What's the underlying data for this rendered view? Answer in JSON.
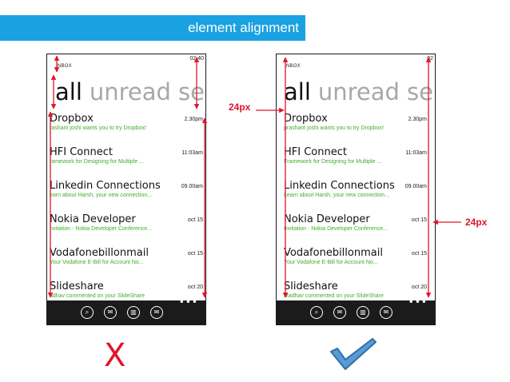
{
  "banner": {
    "title": "element alignment"
  },
  "phones": [
    {
      "status_time": "02:40",
      "inbox_label": "NBOX",
      "pivot": {
        "active": "all",
        "inactive": [
          "unread",
          "se"
        ]
      },
      "items": [
        {
          "title": "Dropbox",
          "subtitle": "rashant joshi wants you to try Dropbox!",
          "date": "2.30pm"
        },
        {
          "title": "HFI Connect",
          "subtitle": "ramework for Designing for Multiple ...",
          "date": "11:03am"
        },
        {
          "title": "Linkedin Connections",
          "subtitle": "earn about Harsh, your new connection...",
          "date": "09.00am"
        },
        {
          "title": "Nokia Developer",
          "subtitle": "nvitation - Nokia Developer Conference...",
          "date": "oct 15"
        },
        {
          "title": "Vodafonebillonmail",
          "subtitle": "Your Vodafone E-Bill for Account No...",
          "date": "oct 15"
        },
        {
          "title": "Slideshare",
          "subtitle": "adhav commented on your SlideShare",
          "date": "oct 20"
        }
      ]
    },
    {
      "status_time": "02",
      "inbox_label": "NBOX",
      "pivot": {
        "active": "all",
        "inactive": [
          "unread",
          "se"
        ]
      },
      "items": [
        {
          "title": "Dropbox",
          "subtitle": "prashant joshi wants you to try Dropbox!",
          "date": "2.30pm"
        },
        {
          "title": "HFI Connect",
          "subtitle": "Framework for Designing for Multiple ...",
          "date": "11:03am"
        },
        {
          "title": "Linkedin Connections",
          "subtitle": "Learn about Harsh, your new connection...",
          "date": "09.00am"
        },
        {
          "title": "Nokia Developer",
          "subtitle": "Invitation - Nokia Developer Conference...",
          "date": "oct 15"
        },
        {
          "title": "Vodafonebillonmail",
          "subtitle": "Your Vodafone E-Bill for Account No...",
          "date": "oct 15"
        },
        {
          "title": "Slideshare",
          "subtitle": "Madhav commented on your SlideShare",
          "date": "oct 20"
        }
      ]
    }
  ],
  "app_bar": {
    "icons": [
      "search-icon",
      "email-icon",
      "delete-icon",
      "compose-icon"
    ],
    "more": "•••"
  },
  "annotations": {
    "margin_label_left": "24px",
    "margin_label_right": "24px",
    "wrong_mark": "X",
    "correct_mark": "check-icon"
  },
  "colors": {
    "banner": "#1aa1e1",
    "annotation_red": "#e0142b",
    "subtitle_green": "#3fae2a",
    "app_bar": "#1b1b1b",
    "check_blue": "#5b9bd5"
  }
}
